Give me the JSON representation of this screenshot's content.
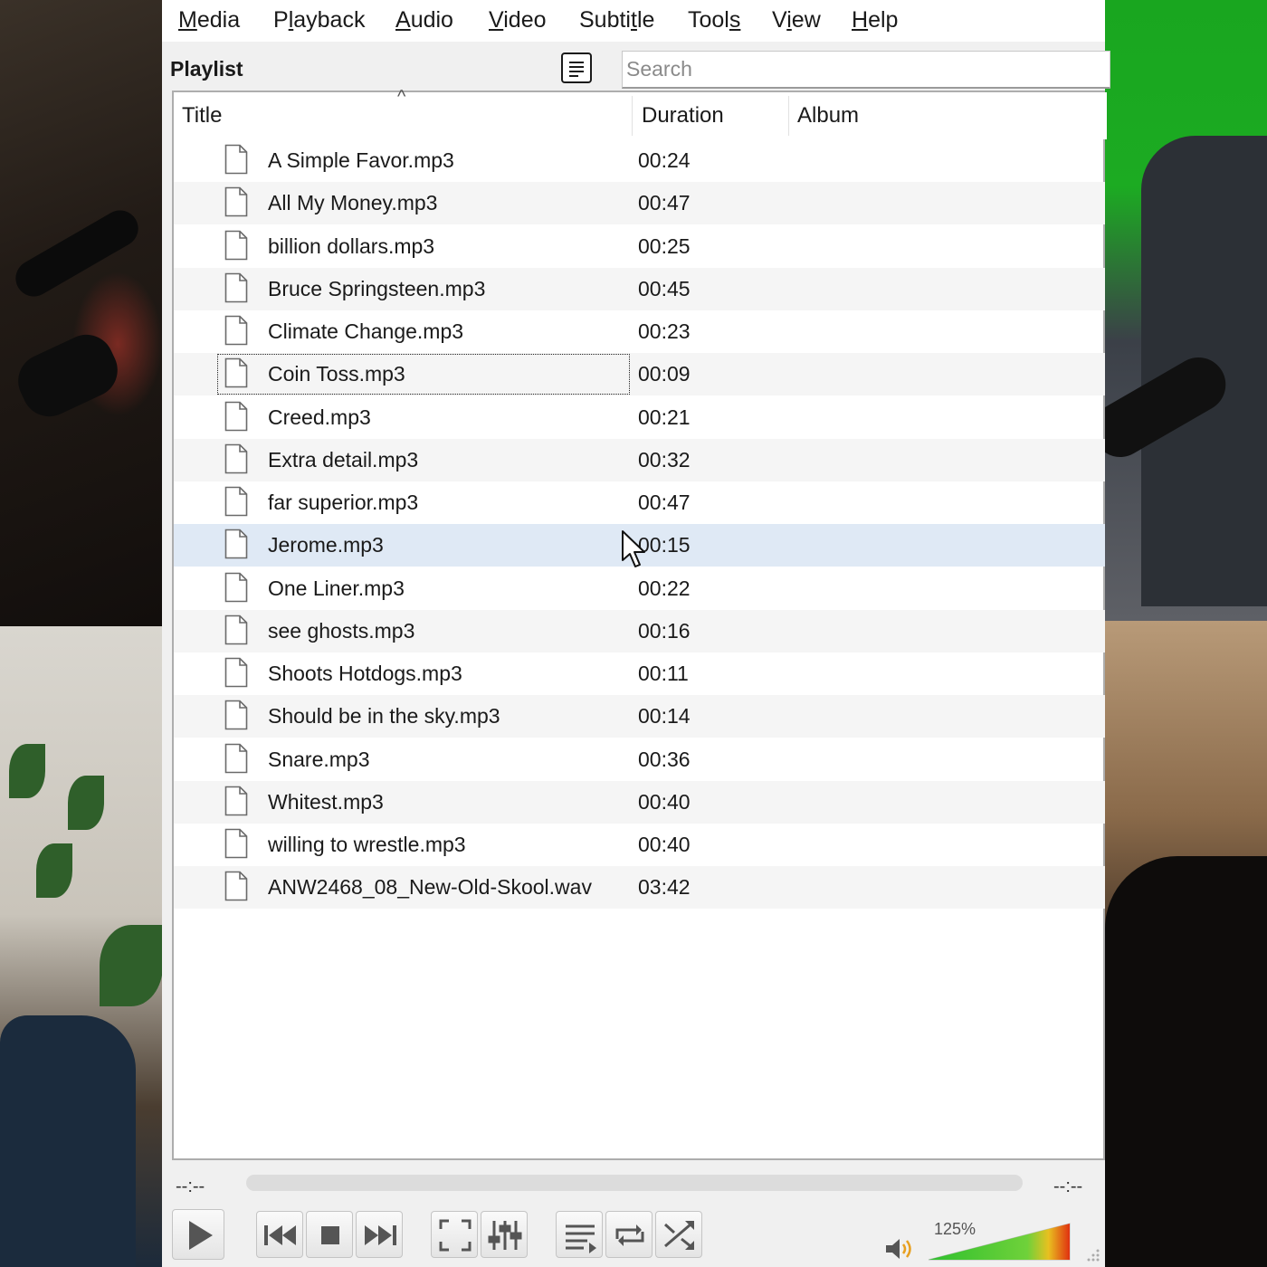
{
  "menubar": {
    "items": [
      {
        "pre": "",
        "u": "M",
        "post": "edia"
      },
      {
        "pre": "P",
        "u": "l",
        "post": "ayback"
      },
      {
        "pre": "",
        "u": "A",
        "post": "udio"
      },
      {
        "pre": "",
        "u": "V",
        "post": "ideo"
      },
      {
        "pre": "Subti",
        "u": "t",
        "post": "le"
      },
      {
        "pre": "Tool",
        "u": "s",
        "post": ""
      },
      {
        "pre": "V",
        "u": "i",
        "post": "ew"
      },
      {
        "pre": "",
        "u": "H",
        "post": "elp"
      }
    ]
  },
  "playlist": {
    "title": "Playlist",
    "search_placeholder": "Search",
    "columns": {
      "title": "Title",
      "duration": "Duration",
      "album": "Album"
    },
    "sort_indicator": "^",
    "focused_index": 5,
    "hovered_index": 9,
    "items": [
      {
        "title": "A Simple Favor.mp3",
        "duration": "00:24"
      },
      {
        "title": "All My Money.mp3",
        "duration": "00:47"
      },
      {
        "title": "billion dollars.mp3",
        "duration": "00:25"
      },
      {
        "title": "Bruce Springsteen.mp3",
        "duration": "00:45"
      },
      {
        "title": "Climate Change.mp3",
        "duration": "00:23"
      },
      {
        "title": "Coin Toss.mp3",
        "duration": "00:09"
      },
      {
        "title": "Creed.mp3",
        "duration": "00:21"
      },
      {
        "title": "Extra detail.mp3",
        "duration": "00:32"
      },
      {
        "title": "far superior.mp3",
        "duration": "00:47"
      },
      {
        "title": "Jerome.mp3",
        "duration": "00:15"
      },
      {
        "title": "One Liner.mp3",
        "duration": "00:22"
      },
      {
        "title": "see ghosts.mp3",
        "duration": "00:16"
      },
      {
        "title": "Shoots Hotdogs.mp3",
        "duration": "00:11"
      },
      {
        "title": "Should be in the sky.mp3",
        "duration": "00:14"
      },
      {
        "title": "Snare.mp3",
        "duration": "00:36"
      },
      {
        "title": "Whitest.mp3",
        "duration": "00:40"
      },
      {
        "title": "willing to wrestle.mp3",
        "duration": "00:40"
      },
      {
        "title": "ANW2468_08_New-Old-Skool.wav",
        "duration": "03:42"
      }
    ]
  },
  "player": {
    "elapsed": "--:--",
    "remaining": "--:--",
    "volume_label": "125%",
    "volume_fraction": 1.0,
    "controls": [
      "play-icon",
      "previous-icon",
      "stop-icon",
      "next-icon",
      "fullscreen-icon",
      "equalizer-icon",
      "playlist-icon",
      "loop-icon",
      "shuffle-icon"
    ]
  },
  "colors": {
    "hover_row": "#dfe9f5",
    "alt_row": "#f5f5f5",
    "green_screen": "#1cab22"
  }
}
